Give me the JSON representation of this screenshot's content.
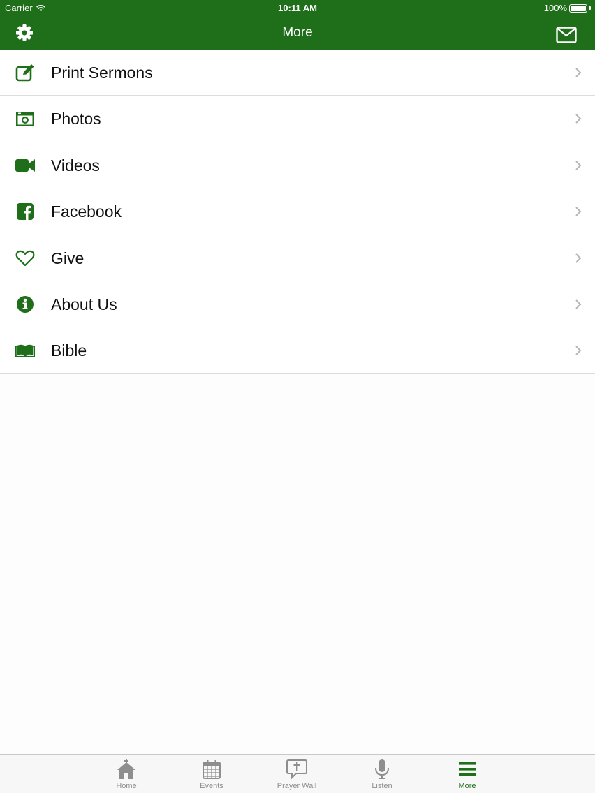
{
  "status_bar": {
    "carrier": "Carrier",
    "time": "10:11 AM",
    "battery": "100%",
    "wifi_icon": "wifi-icon",
    "battery_icon": "battery-icon"
  },
  "nav": {
    "title": "More",
    "left_icon": "gear-icon",
    "right_icon": "envelope-icon"
  },
  "colors": {
    "brand": "#1e6e1a",
    "separator": "#dcdcdc",
    "chevron": "#b5b5b5",
    "tab_inactive": "#8e8e8e"
  },
  "menu": {
    "items": [
      {
        "label": "Print Sermons",
        "icon": "edit-icon"
      },
      {
        "label": "Photos",
        "icon": "camera-icon"
      },
      {
        "label": "Videos",
        "icon": "video-camera-icon"
      },
      {
        "label": "Facebook",
        "icon": "facebook-icon"
      },
      {
        "label": "Give",
        "icon": "heart-icon"
      },
      {
        "label": "About Us",
        "icon": "info-icon"
      },
      {
        "label": "Bible",
        "icon": "book-icon"
      }
    ]
  },
  "tabbar": {
    "active": "More",
    "tabs": [
      {
        "label": "Home",
        "icon": "church-icon"
      },
      {
        "label": "Events",
        "icon": "calendar-icon"
      },
      {
        "label": "Prayer Wall",
        "icon": "prayer-bubble-icon"
      },
      {
        "label": "Listen",
        "icon": "microphone-icon"
      },
      {
        "label": "More",
        "icon": "menu-icon"
      }
    ]
  }
}
